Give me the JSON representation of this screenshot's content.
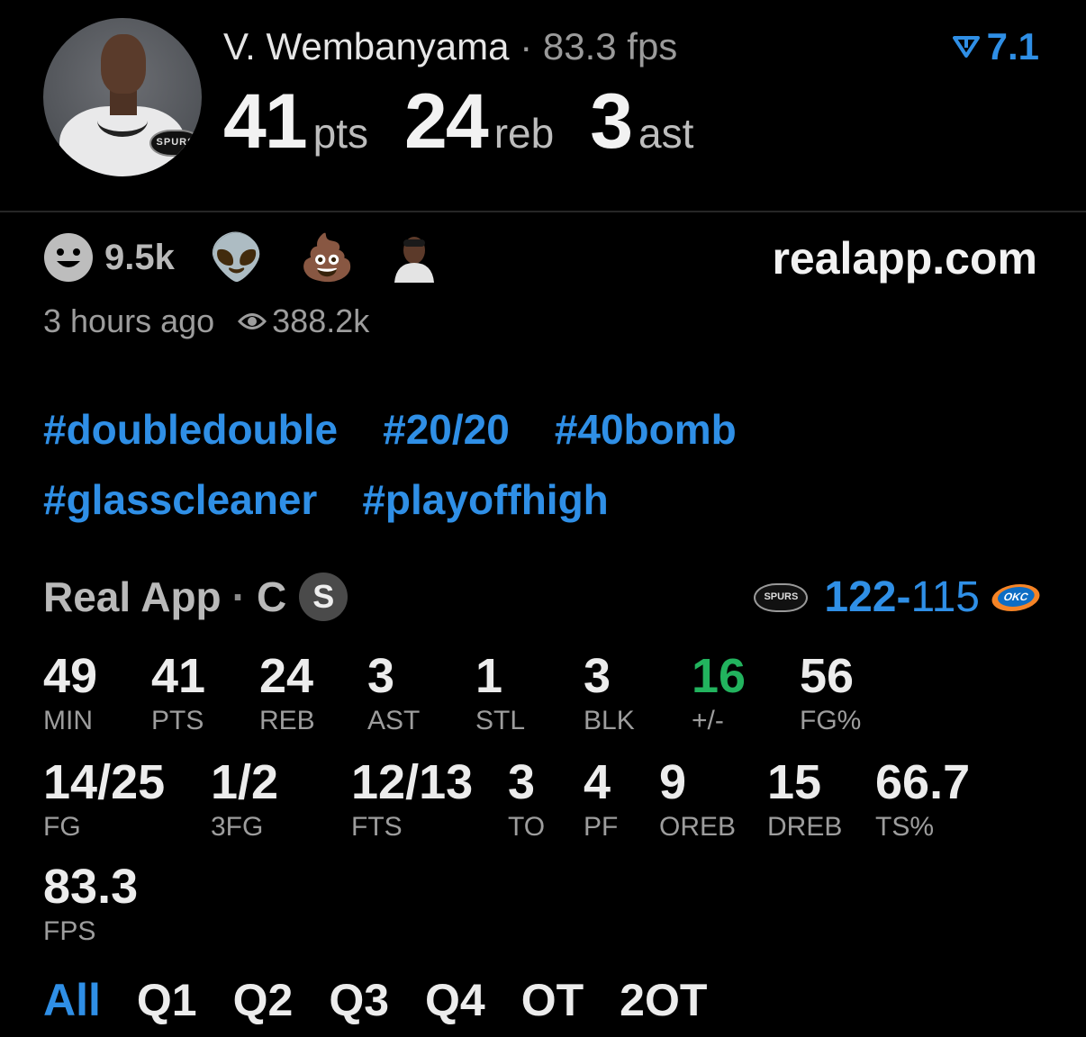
{
  "player": {
    "name": "V. Wembanyama",
    "dot": "·",
    "fps_text": "83.3 fps",
    "team_badge": "SPURS"
  },
  "headline": [
    {
      "value": "41",
      "unit": "pts"
    },
    {
      "value": "24",
      "unit": "reb"
    },
    {
      "value": "3",
      "unit": "ast"
    }
  ],
  "rating": {
    "icon": "real-logo-icon",
    "value": "7.1"
  },
  "reactions": {
    "smile_count": "9.5k",
    "emojis": [
      "👽",
      "💩"
    ]
  },
  "site": "realapp.com",
  "meta": {
    "time": "3 hours ago",
    "views": "388.2k"
  },
  "tags": [
    [
      "#doubledouble",
      "#20/20",
      "#40bomb"
    ],
    [
      "#glasscleaner",
      "#playoffhigh"
    ]
  ],
  "game": {
    "source": "Real App",
    "dot": "·",
    "position": "C",
    "badge": "S",
    "home_logo": "SPURS",
    "score_win": "122",
    "score_sep": "-",
    "score_lose": "115",
    "away_logo": "OKC"
  },
  "stats": [
    {
      "value": "49",
      "label": "MIN"
    },
    {
      "value": "41",
      "label": "PTS"
    },
    {
      "value": "24",
      "label": "REB"
    },
    {
      "value": "3",
      "label": "AST"
    },
    {
      "value": "1",
      "label": "STL"
    },
    {
      "value": "3",
      "label": "BLK"
    },
    {
      "value": "16",
      "label": "+/-"
    },
    {
      "value": "56",
      "label": "FG%"
    },
    {
      "value": "14/25",
      "label": "FG"
    },
    {
      "value": "1/2",
      "label": "3FG"
    },
    {
      "value": "12/13",
      "label": "FTS"
    },
    {
      "value": "3",
      "label": "TO"
    },
    {
      "value": "4",
      "label": "PF"
    },
    {
      "value": "9",
      "label": "OREB"
    },
    {
      "value": "15",
      "label": "DREB"
    },
    {
      "value": "66.7",
      "label": "TS%"
    },
    {
      "value": "83.3",
      "label": "FPS"
    }
  ],
  "periods": [
    "All",
    "Q1",
    "Q2",
    "Q3",
    "Q4",
    "OT",
    "2OT"
  ],
  "colors": {
    "accent": "#2f8fe6",
    "positive": "#22b35e"
  }
}
